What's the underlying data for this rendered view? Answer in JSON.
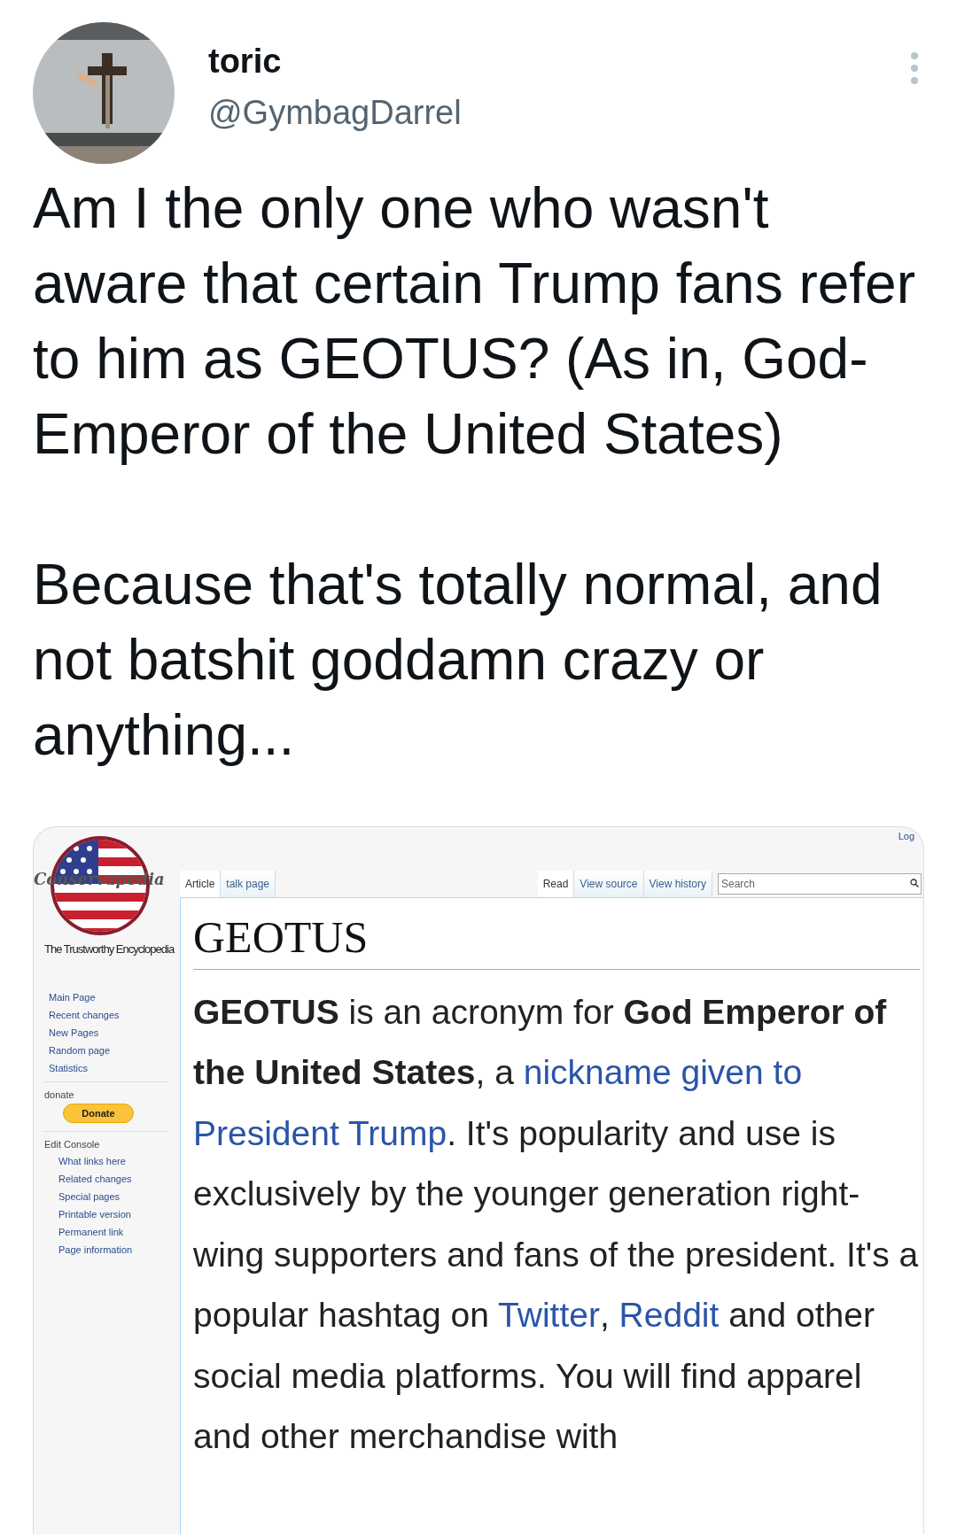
{
  "author": {
    "name": "toric",
    "handle": "@GymbagDarrel"
  },
  "tweet_text": [
    "Am I the only one who wasn't aware that certain Trump fans refer to him as GEOTUS? (As in, God-Emperor of the United States)",
    "Because that's totally normal, and not batshit goddamn crazy or anything..."
  ],
  "wiki": {
    "logo_text": "Conservapedia",
    "tagline": "The Trustworthy Encyclopedia",
    "login": "Log",
    "nav_links": [
      "Main Page",
      "Recent changes",
      "New Pages",
      "Random page",
      "Statistics"
    ],
    "donate_label": "donate",
    "donate_button": "Donate",
    "console_label": "Edit Console",
    "console_links": [
      "What links here",
      "Related changes",
      "Special pages",
      "Printable version",
      "Permanent link",
      "Page information"
    ],
    "left_tabs": [
      {
        "label": "Article",
        "selected": true
      },
      {
        "label": "talk page",
        "selected": false
      }
    ],
    "right_tabs": [
      {
        "label": "Read",
        "selected": true
      },
      {
        "label": "View source",
        "selected": false
      },
      {
        "label": "View history",
        "selected": false
      }
    ],
    "search": {
      "placeholder": "Search"
    },
    "title": "GEOTUS",
    "paragraph": [
      {
        "kind": "bold",
        "text": "GEOTUS"
      },
      {
        "kind": "plain",
        "text": " is an acronym for "
      },
      {
        "kind": "bold",
        "text": "God Emperor of the United States"
      },
      {
        "kind": "plain",
        "text": ", a "
      },
      {
        "kind": "link",
        "text": "nickname given to "
      },
      {
        "kind": "link",
        "text": "President Trump"
      },
      {
        "kind": "plain",
        "text": ". It's popularity and use is exclusively by the younger generation right-wing supporters and fans of the president. It's a popular hashtag on "
      },
      {
        "kind": "link",
        "text": "Twitter"
      },
      {
        "kind": "plain",
        "text": ", "
      },
      {
        "kind": "link",
        "text": "Reddit"
      },
      {
        "kind": "plain",
        "text": " and other social media platforms. You will find apparel and other merchandise with"
      }
    ]
  }
}
